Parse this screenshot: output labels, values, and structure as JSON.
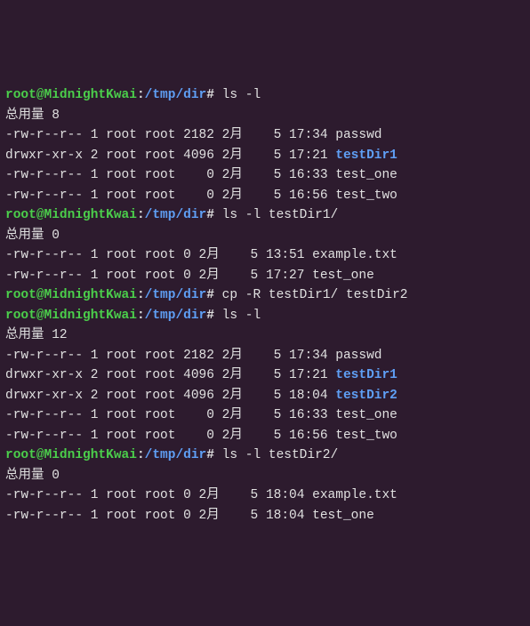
{
  "prompt": {
    "user": "root",
    "at": "@",
    "host": "MidnightKwai",
    "colon": ":",
    "path": "/tmp/dir",
    "hash": "#"
  },
  "blocks": [
    {
      "cmd": "ls -l",
      "total": "总用量 8",
      "rows": [
        {
          "perm": "-rw-r--r--",
          "links": "1",
          "owner": "root",
          "group": "root",
          "size": "2182",
          "month": "2月",
          "day": "5",
          "time": "17:34",
          "name": "passwd",
          "isdir": false
        },
        {
          "perm": "drwxr-xr-x",
          "links": "2",
          "owner": "root",
          "group": "root",
          "size": "4096",
          "month": "2月",
          "day": "5",
          "time": "17:21",
          "name": "testDir1",
          "isdir": true
        },
        {
          "perm": "-rw-r--r--",
          "links": "1",
          "owner": "root",
          "group": "root",
          "size": "0",
          "month": "2月",
          "day": "5",
          "time": "16:33",
          "name": "test_one",
          "isdir": false
        },
        {
          "perm": "-rw-r--r--",
          "links": "1",
          "owner": "root",
          "group": "root",
          "size": "0",
          "month": "2月",
          "day": "5",
          "time": "16:56",
          "name": "test_two",
          "isdir": false
        }
      ]
    },
    {
      "cmd": "ls -l testDir1/",
      "total": "总用量 0",
      "rows": [
        {
          "perm": "-rw-r--r--",
          "links": "1",
          "owner": "root",
          "group": "root",
          "size": "0",
          "month": "2月",
          "day": "5",
          "time": "13:51",
          "name": "example.txt",
          "isdir": false
        },
        {
          "perm": "-rw-r--r--",
          "links": "1",
          "owner": "root",
          "group": "root",
          "size": "0",
          "month": "2月",
          "day": "5",
          "time": "17:27",
          "name": "test_one",
          "isdir": false
        }
      ]
    },
    {
      "cmd": "cp -R testDir1/ testDir2",
      "total": null,
      "rows": []
    },
    {
      "cmd": "ls -l",
      "total": "总用量 12",
      "rows": [
        {
          "perm": "-rw-r--r--",
          "links": "1",
          "owner": "root",
          "group": "root",
          "size": "2182",
          "month": "2月",
          "day": "5",
          "time": "17:34",
          "name": "passwd",
          "isdir": false
        },
        {
          "perm": "drwxr-xr-x",
          "links": "2",
          "owner": "root",
          "group": "root",
          "size": "4096",
          "month": "2月",
          "day": "5",
          "time": "17:21",
          "name": "testDir1",
          "isdir": true
        },
        {
          "perm": "drwxr-xr-x",
          "links": "2",
          "owner": "root",
          "group": "root",
          "size": "4096",
          "month": "2月",
          "day": "5",
          "time": "18:04",
          "name": "testDir2",
          "isdir": true
        },
        {
          "perm": "-rw-r--r--",
          "links": "1",
          "owner": "root",
          "group": "root",
          "size": "0",
          "month": "2月",
          "day": "5",
          "time": "16:33",
          "name": "test_one",
          "isdir": false
        },
        {
          "perm": "-rw-r--r--",
          "links": "1",
          "owner": "root",
          "group": "root",
          "size": "0",
          "month": "2月",
          "day": "5",
          "time": "16:56",
          "name": "test_two",
          "isdir": false
        }
      ]
    },
    {
      "cmd": "ls -l testDir2/",
      "total": "总用量 0",
      "rows": [
        {
          "perm": "-rw-r--r--",
          "links": "1",
          "owner": "root",
          "group": "root",
          "size": "0",
          "month": "2月",
          "day": "5",
          "time": "18:04",
          "name": "example.txt",
          "isdir": false
        },
        {
          "perm": "-rw-r--r--",
          "links": "1",
          "owner": "root",
          "group": "root",
          "size": "0",
          "month": "2月",
          "day": "5",
          "time": "18:04",
          "name": "test_one",
          "isdir": false
        }
      ]
    }
  ]
}
